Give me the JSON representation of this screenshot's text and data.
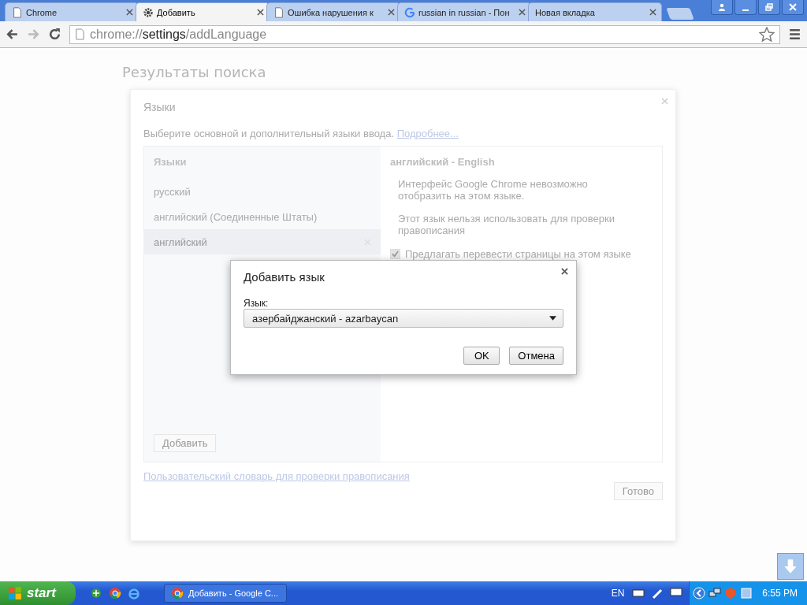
{
  "tabs": [
    {
      "title": "Chrome",
      "kind": "page",
      "selected": false
    },
    {
      "title": "Добавить",
      "kind": "settings",
      "selected": true
    },
    {
      "title": "Ошибка нарушения к",
      "kind": "page",
      "selected": false
    },
    {
      "title": "russian in russian - Пон",
      "kind": "search",
      "selected": false
    },
    {
      "title": "Новая вкладка",
      "kind": "blank",
      "selected": false
    }
  ],
  "address": {
    "scheme": "chrome://",
    "host": "settings",
    "path": "/addLanguage"
  },
  "page": {
    "heading": "Результаты поиска"
  },
  "languages_dialog": {
    "title": "Языки",
    "intro": "Выберите основной и дополнительный языки ввода.",
    "link": "Подробнее...",
    "list_header": "Языки",
    "languages": [
      {
        "name": "русский",
        "selected": false
      },
      {
        "name": "английский (Соединенные Штаты)",
        "selected": false
      },
      {
        "name": "английский",
        "selected": true
      }
    ],
    "add_button": "Добавить",
    "detail_title": "английский - English",
    "notes": [
      "Интерфейс Google Chrome невозможно отобразить на этом языке.",
      "Этот язык нельзя использовать для проверки правописания"
    ],
    "offer_translate": {
      "label": "Предлагать перевести страницы на этом языке",
      "checked": true
    },
    "dictionary_link": "Пользовательский словарь для проверки правописания",
    "done_button": "Готово"
  },
  "add_dialog": {
    "title": "Добавить язык",
    "field_label": "Язык:",
    "value": "азербайджанский - azarbaycan",
    "buttons": [
      "OK",
      "Отмена"
    ]
  },
  "taskbar": {
    "start": "start",
    "task": "Добавить - Google C...",
    "lang": "EN",
    "clock": "6:55 PM"
  }
}
